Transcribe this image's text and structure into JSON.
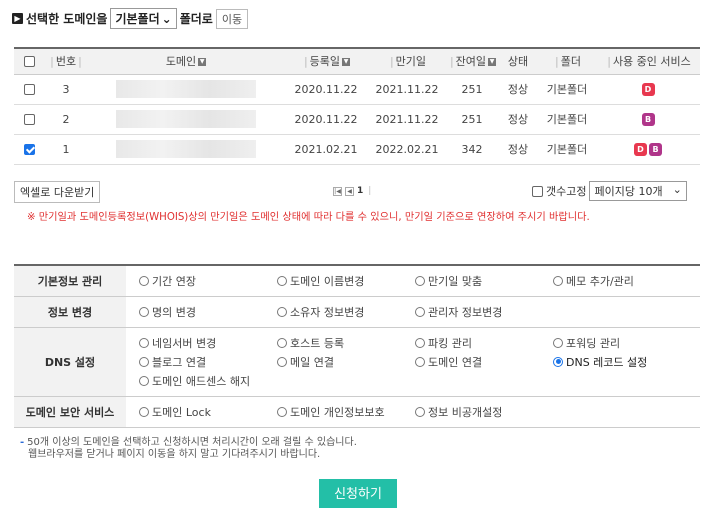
{
  "move_bar": {
    "icon": "black-square-icon",
    "label_before": "선택한 도메인을",
    "folder_selected": "기본폴더",
    "label_after": "폴더로",
    "move_button": "이동"
  },
  "domain_table": {
    "headers": [
      "번호",
      "도메인",
      "등록일",
      "만기일",
      "잔여일",
      "상태",
      "폴더",
      "사용 중인 서비스"
    ],
    "rows": [
      {
        "num": "3",
        "registered": "2020.11.22",
        "expires": "2021.11.22",
        "remaining": "251",
        "status": "정상",
        "folder": "기본폴더",
        "checked": false,
        "services": [
          "D"
        ]
      },
      {
        "num": "2",
        "registered": "2020.11.22",
        "expires": "2021.11.22",
        "remaining": "251",
        "status": "정상",
        "folder": "기본폴더",
        "checked": false,
        "services": [
          "B"
        ]
      },
      {
        "num": "1",
        "registered": "2021.02.21",
        "expires": "2022.02.21",
        "remaining": "342",
        "status": "정상",
        "folder": "기본폴더",
        "checked": true,
        "services": [
          "D",
          "B"
        ]
      }
    ],
    "service_colors": {
      "D": "#e8384f",
      "B": "#b0358a"
    }
  },
  "table_footer": {
    "excel_button": "엑셀로 다운받기",
    "current_page": "1",
    "fix_count_label": "갯수고정",
    "per_page": "페이지당 10개"
  },
  "warning": "※ 만기일과 도메인등록정보(WHOIS)상의 만기일은 도메인 상태에 따라 다를 수 있으니, 만기일 기준으로 연장하여 주시기 바랍니다.",
  "options": [
    {
      "category": "기본정보 관리",
      "lines": [
        [
          "기간 연장",
          "도메인 이름변경",
          "만기일 맞춤",
          "메모 추가/관리"
        ]
      ]
    },
    {
      "category": "정보 변경",
      "lines": [
        [
          "명의 변경",
          "소유자 정보변경",
          "관리자 정보변경"
        ]
      ]
    },
    {
      "category": "DNS 설정",
      "lines": [
        [
          "네임서버 변경",
          "호스트 등록",
          "파킹 관리",
          "포워딩 관리"
        ],
        [
          "블로그 연결",
          "메일 연결",
          "도메인 연결",
          "DNS 레코드 설정"
        ],
        [
          "도메인 애드센스 해지"
        ]
      ]
    },
    {
      "category": "도메인 보안 서비스",
      "lines": [
        [
          "도메인 Lock",
          "도메인 개인정보보호",
          "정보 비공개설정"
        ]
      ]
    }
  ],
  "selected_option": "DNS 레코드 설정",
  "notes": {
    "line1": "50개 이상의 도메인을 선택하고 신청하시면 처리시간이 오래 걸릴 수 있습니다.",
    "line2": "웹브라우저를 닫거나 페이지 이동을 하지 말고 기다려주시기 바랍니다."
  },
  "submit_label": "신청하기"
}
